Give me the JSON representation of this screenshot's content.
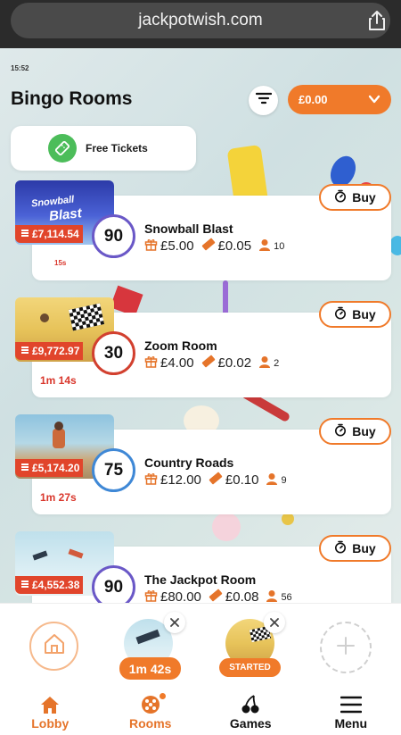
{
  "browser": {
    "url": "jackpotwish.com"
  },
  "status": {
    "time": "15:52"
  },
  "header": {
    "title": "Bingo Rooms",
    "balance": "£0.00"
  },
  "free_tickets": {
    "label": "Free Tickets"
  },
  "rooms": [
    {
      "name": "Snowball Blast",
      "ball": "90",
      "jackpot": "£7,114.54",
      "price": "£5.00",
      "ticket": "£0.05",
      "players": "10",
      "timer": "15s",
      "buy": "Buy",
      "ball_color": "#6a58c7",
      "img_label_1": "Snowball",
      "img_label_2": "Blast"
    },
    {
      "name": "Zoom Room",
      "ball": "30",
      "jackpot": "£9,772.97",
      "price": "£4.00",
      "ticket": "£0.02",
      "players": "2",
      "timer": "1m 14s",
      "buy": "Buy",
      "ball_color": "#d2402f"
    },
    {
      "name": "Country Roads",
      "ball": "75",
      "jackpot": "£5,174.20",
      "price": "£12.00",
      "ticket": "£0.10",
      "players": "9",
      "timer": "1m 27s",
      "buy": "Buy",
      "ball_color": "#3f88d6"
    },
    {
      "name": "The Jackpot Room",
      "ball": "90",
      "jackpot": "£4,552.38",
      "price": "£80.00",
      "ticket": "£0.08",
      "players": "56",
      "timer": "",
      "buy": "Buy",
      "ball_color": "#6a58c7"
    }
  ],
  "dock": {
    "recent_1_timer": "1m 42s",
    "recent_2_status": "STARTED"
  },
  "tabs": [
    {
      "label": "Lobby",
      "icon": "home-icon"
    },
    {
      "label": "Rooms",
      "icon": "rooms-icon"
    },
    {
      "label": "Games",
      "icon": "cherries-icon"
    },
    {
      "label": "Menu",
      "icon": "hamburger-icon"
    }
  ],
  "colors": {
    "accent": "#f07a2a",
    "jackpot_red": "#e1452b",
    "timer_red": "#d9372c",
    "ticket_green": "#4cbd5a"
  }
}
